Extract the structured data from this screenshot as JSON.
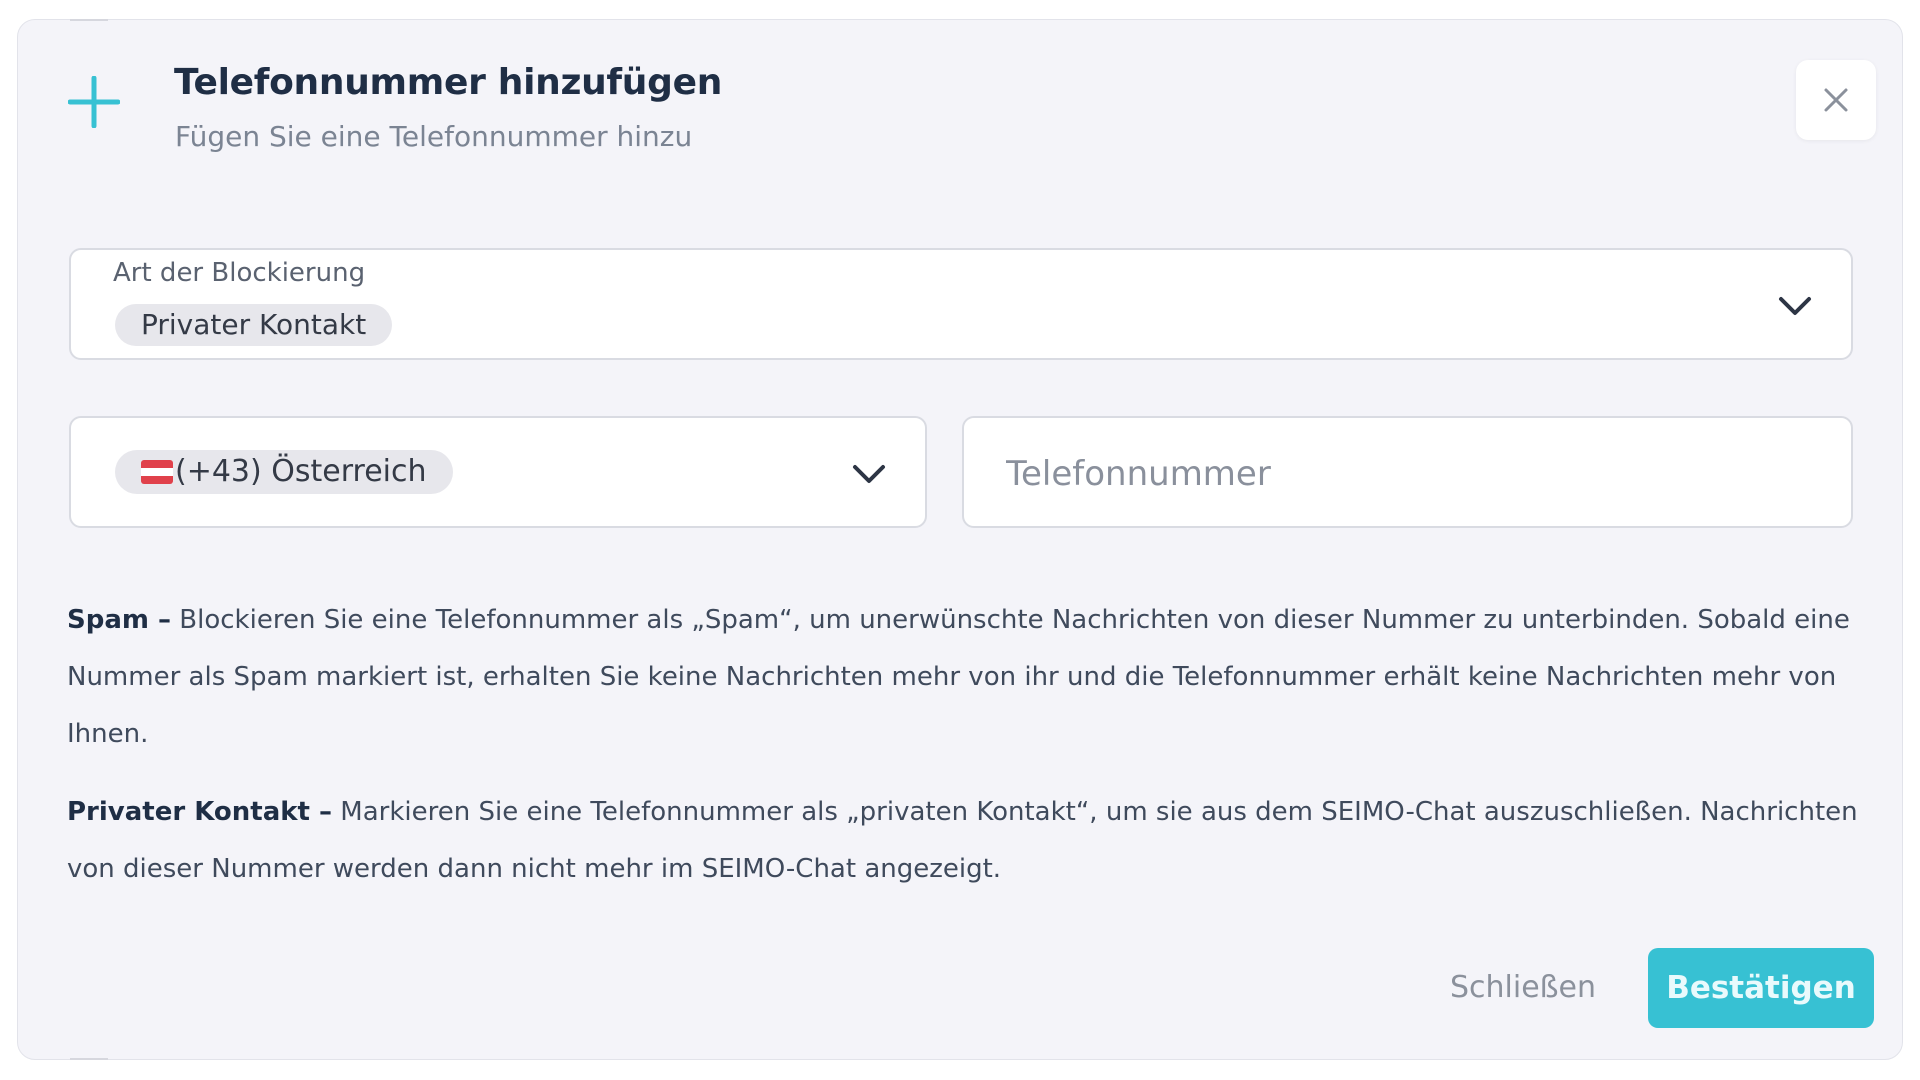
{
  "dialog": {
    "title": "Telefonnummer hinzufügen",
    "subtitle": "Fügen Sie eine Telefonnummer hinzu",
    "plus_icon": "plus-icon",
    "close_icon": "close-icon"
  },
  "block_type": {
    "label": "Art der Blockierung",
    "selected": "Privater Kontakt",
    "icon": "chevron-down-icon"
  },
  "country": {
    "selected": "(+43) Österreich",
    "flag_icon": "austria-flag-icon",
    "icon": "chevron-down-icon"
  },
  "phone": {
    "value": "",
    "placeholder": "Telefonnummer"
  },
  "info": {
    "spam_term": "Spam –",
    "spam_text": "Blockieren Sie eine Telefonnummer als „Spam“, um unerwünschte Nachrichten von dieser Nummer zu unterbinden. Sobald eine Nummer als Spam markiert ist, erhalten Sie keine Nachrichten mehr von ihr und die Telefonnummer erhält keine Nachrichten mehr von Ihnen.",
    "private_term": "Privater Kontakt –",
    "private_text": "Markieren Sie eine Telefonnummer als „privaten Kontakt“, um sie aus dem SEIMO-Chat auszuschließen. Nachrichten von dieser Nummer werden dann nicht mehr im SEIMO-Chat angezeigt."
  },
  "actions": {
    "cancel_label": "Schließen",
    "confirm_label": "Bestätigen"
  },
  "colors": {
    "accent": "#37c1d3",
    "title": "#1f2e45",
    "background": "#f4f4f9",
    "flag_red": "#e0414b"
  }
}
